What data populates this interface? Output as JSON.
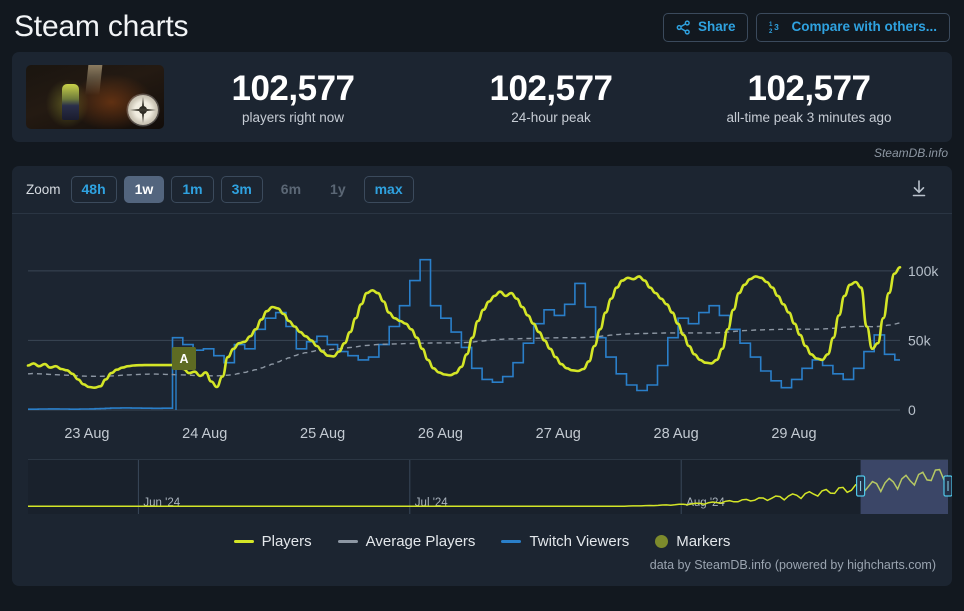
{
  "header": {
    "title": "Steam charts",
    "share_label": "Share",
    "compare_label": "Compare with others..."
  },
  "stats": {
    "thumbnail_alt": "game-capsule",
    "items": [
      {
        "value": "102,577",
        "label": "players right now"
      },
      {
        "value": "102,577",
        "label": "24-hour peak"
      },
      {
        "value": "102,577",
        "label": "all-time peak 3 minutes ago"
      }
    ]
  },
  "attribution": "SteamDB.info",
  "chart": {
    "zoom_label": "Zoom",
    "ranges": [
      {
        "label": "48h",
        "state": "normal"
      },
      {
        "label": "1w",
        "state": "active"
      },
      {
        "label": "1m",
        "state": "normal"
      },
      {
        "label": "3m",
        "state": "normal"
      },
      {
        "label": "6m",
        "state": "disabled"
      },
      {
        "label": "1y",
        "state": "disabled"
      },
      {
        "label": "max",
        "state": "normal"
      }
    ],
    "download_icon": "download-icon",
    "marker_flag": "A",
    "credit": "data by SteamDB.info (powered by highcharts.com)",
    "legend": [
      {
        "label": "Players",
        "color": "#d4e627",
        "type": "line"
      },
      {
        "label": "Average Players",
        "color": "#8d97a3",
        "type": "line"
      },
      {
        "label": "Twitch Viewers",
        "color": "#2a7fc9",
        "type": "line"
      },
      {
        "label": "Markers",
        "color": "#7d8b2c",
        "type": "dot"
      }
    ]
  },
  "chart_data": {
    "type": "line",
    "title": "Steam charts",
    "xlabel": "",
    "ylabel": "",
    "ylim": [
      0,
      115000
    ],
    "yticks": [
      0,
      50000,
      100000
    ],
    "ytick_labels": [
      "0",
      "50k",
      "100k"
    ],
    "grid": true,
    "legend_position": "bottom",
    "x_tick_labels": [
      "23 Aug",
      "24 Aug",
      "25 Aug",
      "26 Aug",
      "27 Aug",
      "28 Aug",
      "29 Aug"
    ],
    "x_range": [
      "23 Aug",
      "30 Aug"
    ],
    "annotations": [
      {
        "label": "A",
        "type": "marker-flag",
        "x_approx": "24 Aug"
      }
    ],
    "series": [
      {
        "name": "Players",
        "color": "#d4e627",
        "values": [
          32000,
          33500,
          31500,
          33000,
          30500,
          31500,
          29500,
          28500,
          26000,
          22000,
          18500,
          16500,
          16000,
          17000,
          22000,
          26500,
          29000,
          30500,
          31500,
          32000,
          32200,
          32300,
          32300,
          32300,
          32300,
          32300,
          32300,
          32300,
          29500,
          26500,
          27500,
          24500,
          27000,
          20500,
          16500,
          24000,
          38000,
          44000,
          48000,
          49000,
          53000,
          58000,
          65000,
          71000,
          74000,
          73000,
          69000,
          64000,
          60000,
          56000,
          53000,
          50000,
          46000,
          42000,
          39000,
          38500,
          42000,
          48000,
          56000,
          66000,
          76000,
          84000,
          86000,
          84000,
          78000,
          70000,
          66000,
          64000,
          62000,
          58000,
          52000,
          44000,
          36000,
          30000,
          27000,
          25500,
          25000,
          26500,
          31000,
          40000,
          52000,
          64000,
          72000,
          78000,
          82000,
          85000,
          82000,
          84000,
          80000,
          74000,
          68000,
          62000,
          56000,
          50000,
          44000,
          38000,
          33000,
          30000,
          28500,
          28000,
          29500,
          35000,
          46000,
          58000,
          70000,
          80000,
          88000,
          93000,
          95000,
          94000,
          96000,
          93000,
          88000,
          84000,
          80000,
          76000,
          70000,
          62000,
          54000,
          46000,
          40000,
          36000,
          34000,
          33500,
          36000,
          44000,
          58000,
          72000,
          84000,
          90000,
          94000,
          96000,
          95000,
          92000,
          88000,
          82000,
          76000,
          70000,
          62000,
          54000,
          46000,
          40000,
          37000,
          36000,
          40000,
          52000,
          68000,
          82000,
          90000,
          92000,
          88000,
          60000,
          44000,
          48000,
          66000,
          84000,
          98000,
          102577
        ]
      },
      {
        "name": "Average Players",
        "color": "#8d97a3",
        "style": "dashed",
        "values": [
          26000,
          26200,
          26000,
          25800,
          25600,
          25400,
          25200,
          25000,
          24800,
          24600,
          24400,
          24300,
          24200,
          24200,
          24300,
          24500,
          24700,
          25000,
          25200,
          25400,
          25600,
          25700,
          25800,
          25800,
          25700,
          25600,
          25500,
          25300,
          25200,
          25000,
          24900,
          24800,
          24700,
          24600,
          24600,
          24700,
          25000,
          25500,
          26200,
          27000,
          28000,
          29000,
          30200,
          31500,
          33000,
          34500,
          36000,
          37500,
          39000,
          40200,
          41200,
          42000,
          42600,
          43000,
          43300,
          43600,
          44000,
          44400,
          44900,
          45400,
          45900,
          46400,
          46800,
          47100,
          47300,
          47400,
          47500,
          47600,
          47700,
          47800,
          47900,
          48000,
          48100,
          48200,
          48200,
          48200,
          48200,
          48300,
          48400,
          48600,
          48900,
          49300,
          49700,
          50100,
          50500,
          50800,
          51000,
          51100,
          51200,
          51300,
          51400,
          51500,
          51600,
          51700,
          51800,
          51900,
          52000,
          52000,
          52000,
          52000,
          52100,
          52300,
          52600,
          53000,
          53400,
          53800,
          54200,
          54500,
          54700,
          54800,
          54900,
          55000,
          55100,
          55200,
          55300,
          55400,
          55400,
          55400,
          55400,
          55400,
          55400,
          55400,
          55400,
          55400,
          55500,
          55700,
          56000,
          56400,
          56800,
          57100,
          57300,
          57500,
          57600,
          57700,
          57800,
          57900,
          58000,
          58100,
          58100,
          58100,
          58100,
          58100,
          58100,
          58200,
          58400,
          58700,
          59100,
          59500,
          59800,
          60000,
          60100,
          60000,
          59900,
          60000,
          60400,
          61000,
          61800,
          62500
        ]
      },
      {
        "name": "Twitch Viewers",
        "color": "#2a7fc9",
        "style": "step",
        "values": [
          600,
          600,
          700,
          700,
          800,
          800,
          700,
          700,
          600,
          600,
          700,
          700,
          800,
          900,
          1000,
          1200,
          1400,
          1400,
          1500,
          1500,
          1400,
          1400,
          1300,
          1300,
          1200,
          1200,
          1300,
          1300,
          52000,
          52000,
          47000,
          47000,
          43000,
          43000,
          44000,
          44000,
          39000,
          39000,
          34000,
          34000,
          47000,
          47000,
          44000,
          44000,
          58000,
          58000,
          66000,
          66000,
          70000,
          70000,
          60000,
          60000,
          44000,
          44000,
          49000,
          49000,
          53000,
          53000,
          47000,
          47000,
          42000,
          42000,
          39000,
          39000,
          36000,
          36000,
          38000,
          38000,
          47000,
          47000,
          60000,
          60000,
          75000,
          75000,
          93000,
          93000,
          108000,
          108000,
          75000,
          75000,
          66000,
          66000,
          56000,
          56000,
          45000,
          45000,
          30000,
          30000,
          22000,
          22000,
          20000,
          20000,
          24000,
          24000,
          34000,
          34000,
          48000,
          48000,
          62000,
          62000,
          72000,
          72000,
          68000,
          68000,
          76000,
          76000,
          91000,
          91000,
          74000,
          74000,
          52000,
          52000,
          38000,
          38000,
          26000,
          26000,
          18000,
          18000,
          14000,
          14000,
          18000,
          18000,
          32000,
          32000,
          52000,
          52000,
          66000,
          66000,
          62000,
          62000,
          70000,
          70000,
          75000,
          75000,
          68000,
          68000,
          58000,
          58000,
          48000,
          48000,
          38000,
          38000,
          28000,
          28000,
          21000,
          21000,
          16000,
          16000,
          22000,
          22000,
          30000,
          30000,
          36000,
          36000,
          32000,
          32000,
          26000,
          26000,
          22000,
          22000,
          30000,
          30000,
          42000,
          42000,
          54000,
          54000,
          40000,
          40000,
          36000,
          36000
        ]
      }
    ]
  },
  "navigator": {
    "tick_labels": [
      "Jun '24",
      "Jul '24",
      "Aug '24"
    ],
    "selection": {
      "start_pct": 90.5,
      "end_pct": 100
    },
    "handle_icon": "drag-handle-icon"
  }
}
